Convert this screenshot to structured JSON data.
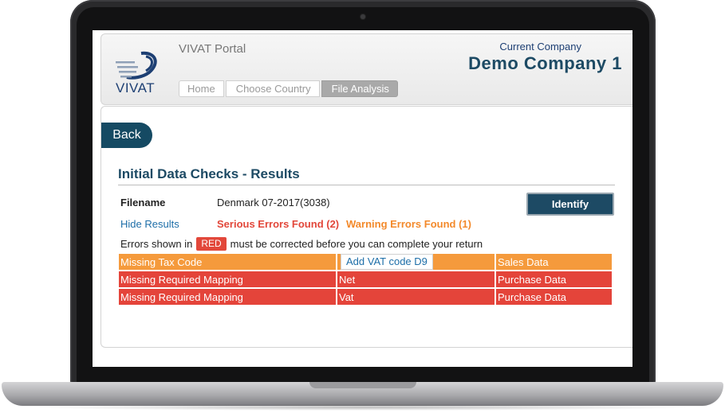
{
  "header": {
    "portal_title": "VIVAT Portal",
    "logo_text": "VIVAT",
    "company_label": "Current Company",
    "company_name": "Demo Company 1",
    "breadcrumb": [
      {
        "label": "Home"
      },
      {
        "label": "Choose Country"
      },
      {
        "label": "File Analysis"
      }
    ]
  },
  "main": {
    "back_label": "Back",
    "section_title": "Initial Data Checks - Results",
    "filename_label": "Filename",
    "filename_value": "Denmark 07-2017(3038)",
    "identify_label": "Identify",
    "hide_results_label": "Hide Results",
    "serious_errors": "Serious Errors Found (2)",
    "warning_errors": "Warning Errors Found (1)",
    "note_prefix": "Errors shown in",
    "note_badge": "RED",
    "note_suffix": "must be corrected before you can complete your return",
    "rows": [
      {
        "issue": "Missing Tax Code",
        "detail": "Add VAT code D9",
        "category": "Sales Data"
      },
      {
        "issue": "Missing Required Mapping",
        "detail": "Net",
        "category": "Purchase Data"
      },
      {
        "issue": "Missing Required Mapping",
        "detail": "Vat",
        "category": "Purchase Data"
      }
    ]
  },
  "colors": {
    "brand": "#1d4a64",
    "error": "#e4443a",
    "warning": "#f59a3c",
    "link": "#1d6ea8"
  }
}
